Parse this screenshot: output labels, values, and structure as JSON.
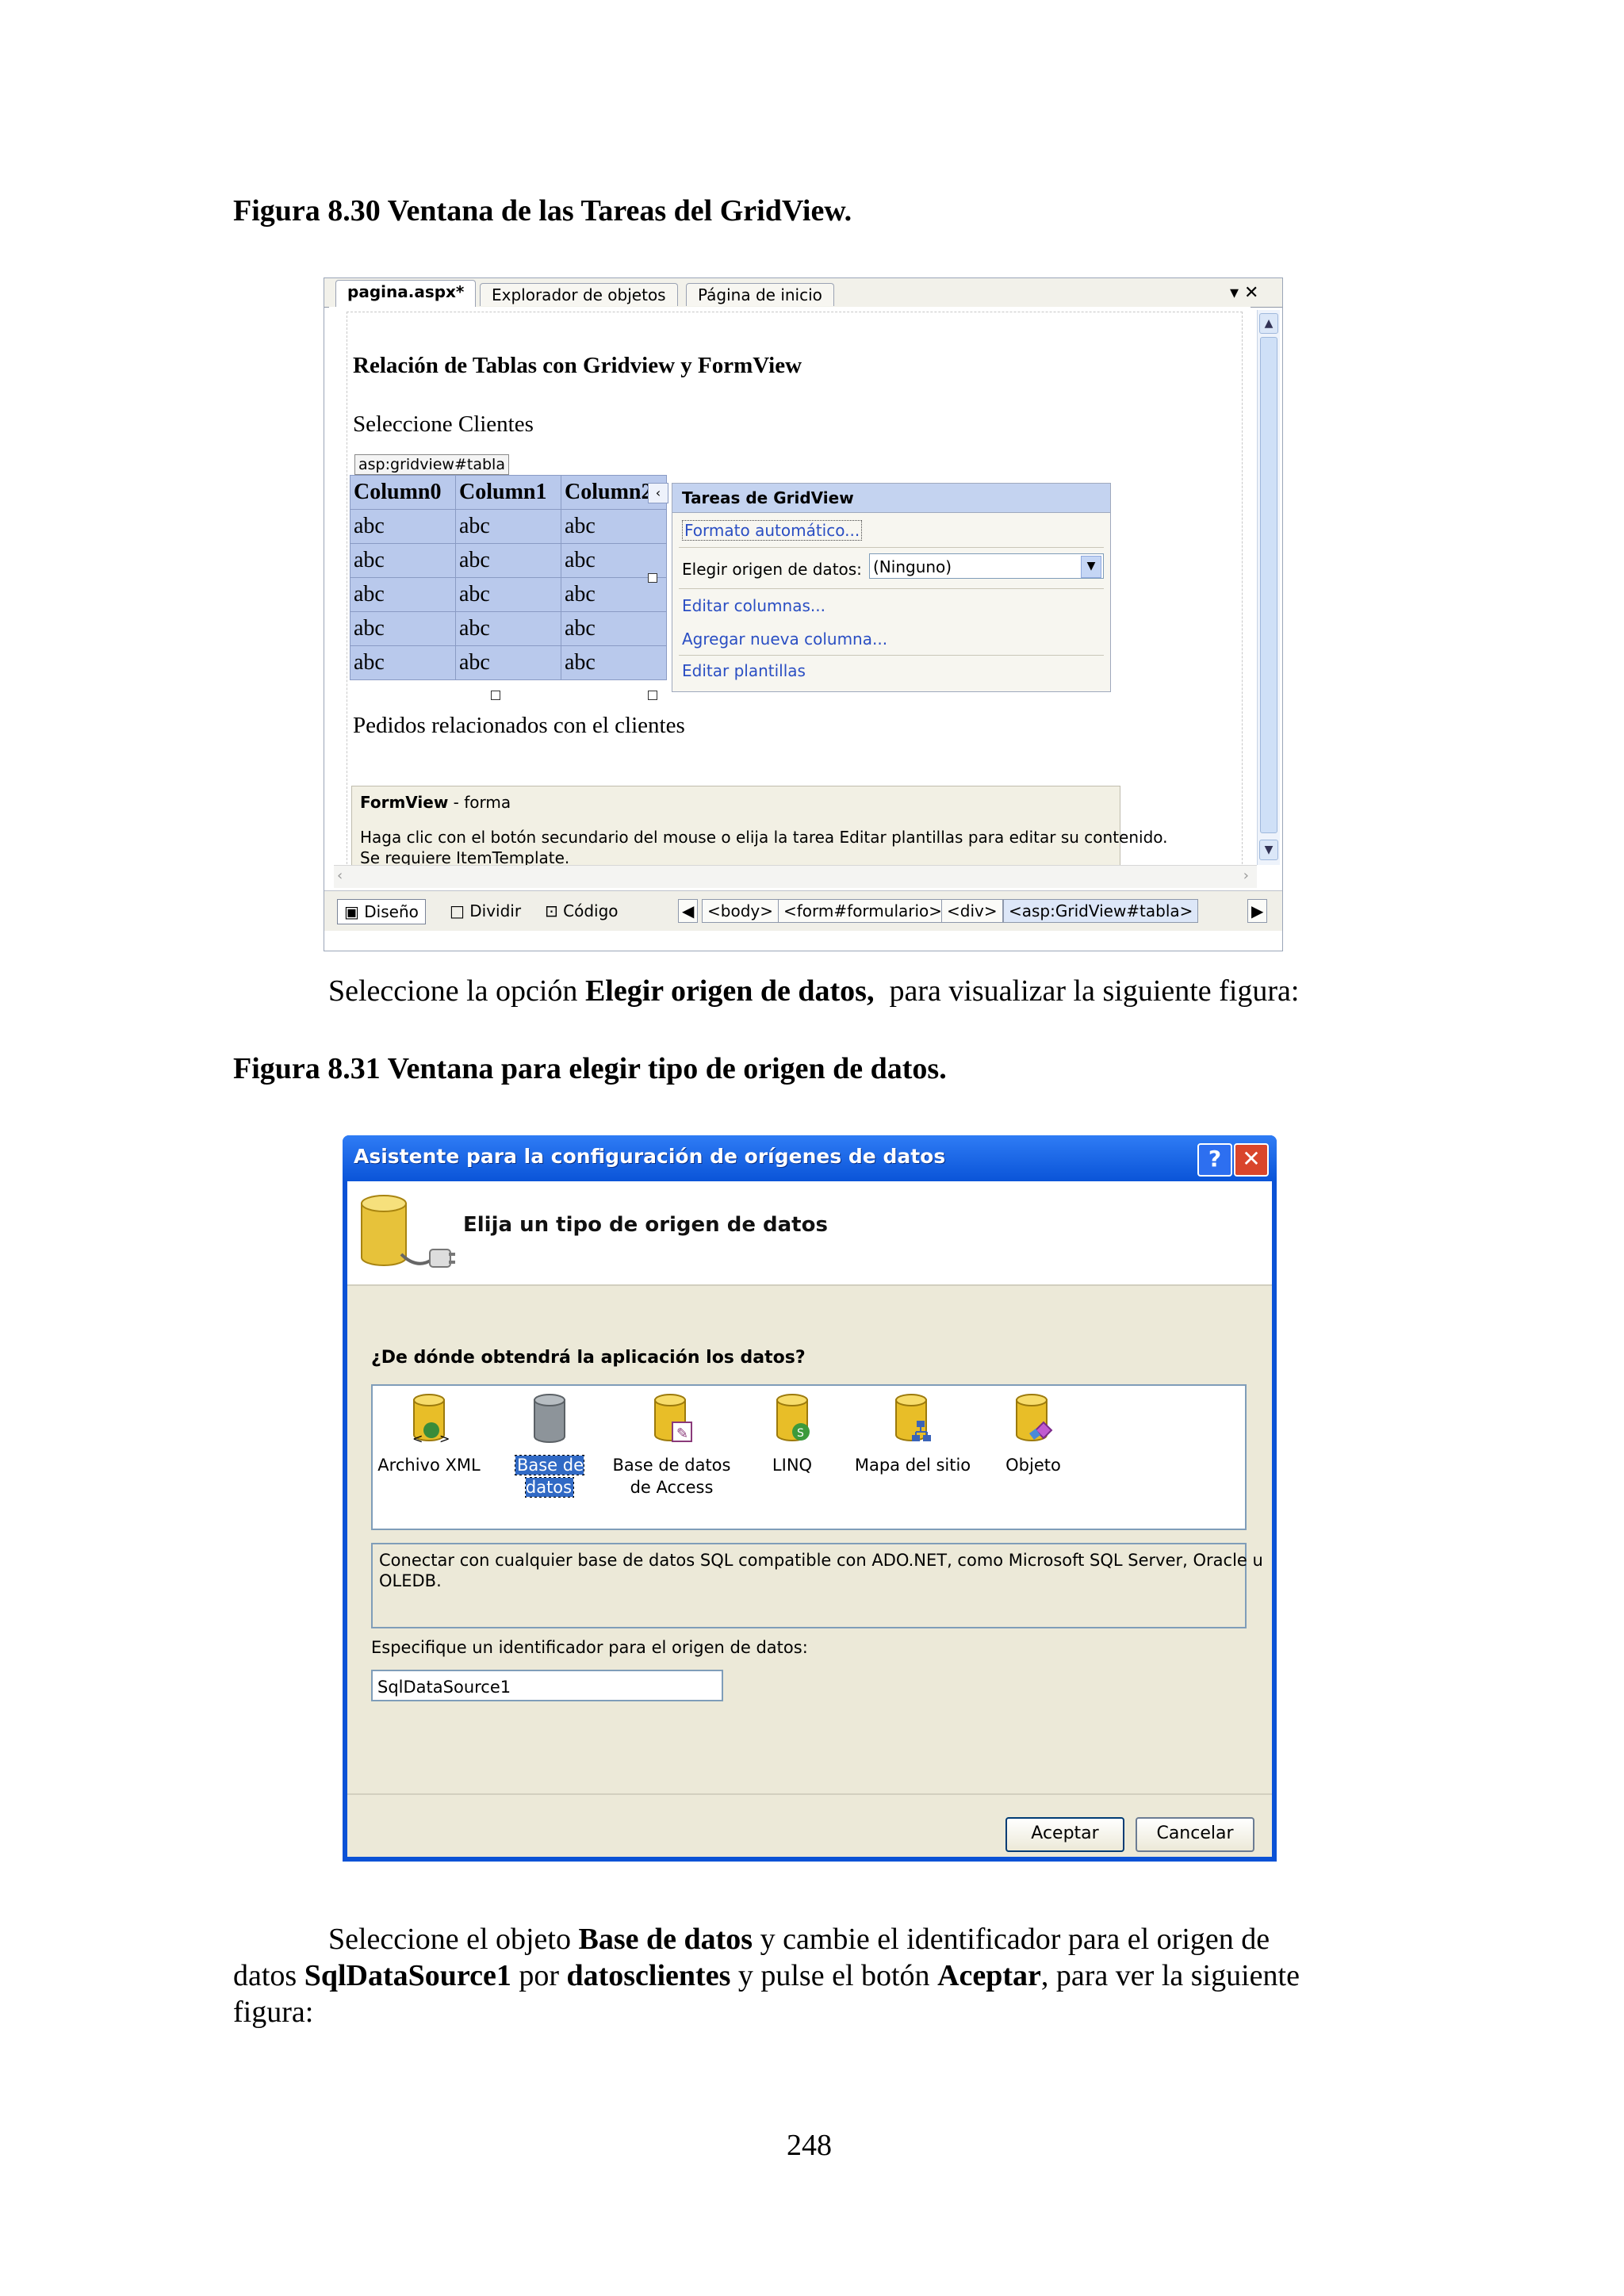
{
  "fig830": {
    "caption": "Figura 8.30 Ventana de las Tareas del GridView."
  },
  "vs": {
    "tabs": [
      "pagina.aspx*",
      "Explorador de objetos",
      "Página de inicio"
    ],
    "close_symbol": "▾ ✕",
    "heading": "Relación de Tablas con Gridview y FormView",
    "select_clients": "Seleccione Clientes",
    "gridview_tag": "asp:gridview#tabla",
    "grid": {
      "headers": [
        "Column0",
        "Column1",
        "Column2"
      ],
      "rows": [
        [
          "abc",
          "abc",
          "abc"
        ],
        [
          "abc",
          "abc",
          "abc"
        ],
        [
          "abc",
          "abc",
          "abc"
        ],
        [
          "abc",
          "abc",
          "abc"
        ],
        [
          "abc",
          "abc",
          "abc"
        ]
      ]
    },
    "tasks": {
      "title": "Tareas de GridView",
      "auto_format": "Formato automático...",
      "datasource_label": "Elegir origen de datos:",
      "datasource_value": "(Ninguno)",
      "edit_columns": "Editar columnas...",
      "add_column": "Agregar nueva columna...",
      "edit_templates": "Editar plantillas"
    },
    "related_orders": "Pedidos relacionados con el clientes",
    "formview": {
      "name_bold": "FormView",
      "name_rest": " - forma",
      "line1": "Haga clic con el botón secundario del mouse o elija la tarea Editar plantillas para editar su contenido.",
      "line2": "Se requiere ItemTemplate."
    },
    "bottom": {
      "design": "Diseño",
      "split": "Dividir",
      "code": "Código",
      "crumbs": [
        "<body>",
        "<form#formulario>",
        "<div>",
        "<asp:GridView#tabla>"
      ]
    }
  },
  "para1": {
    "pre": "Seleccione la opción ",
    "bold": "Elegir origen de datos,",
    "post": "  para visualizar la siguiente figura:"
  },
  "fig831": {
    "caption": "Figura 8.31 Ventana para elegir tipo de origen de datos."
  },
  "dialog": {
    "title": "Asistente para la configuración de orígenes de datos",
    "help_symbol": "?",
    "close_symbol": "✕",
    "header": "Elija un tipo de origen de datos",
    "question": "¿De dónde obtendrá la aplicación los datos?",
    "choices": [
      {
        "line1": "Archivo XML",
        "line2": ""
      },
      {
        "line1": "Base de datos",
        "line2": ""
      },
      {
        "line1": "Base de datos",
        "line2": "de Access"
      },
      {
        "line1": "LINQ",
        "line2": ""
      },
      {
        "line1": "Mapa del sitio",
        "line2": ""
      },
      {
        "line1": "Objeto",
        "line2": ""
      }
    ],
    "description_line1": "Conectar con cualquier base de datos SQL compatible con ADO.NET, como Microsoft SQL Server, Oracle u",
    "description_line2": "OLEDB.",
    "id_label": "Especifique un identificador para el origen de datos:",
    "id_value": "SqlDataSource1",
    "ok": "Aceptar",
    "cancel": "Cancelar",
    "colors": {
      "title_bar": "#0a54d8",
      "selection": "#316ac5",
      "close_button": "#d9452b"
    }
  },
  "para2": {
    "s1": "Seleccione el objeto ",
    "b1": "Base de datos",
    "s2": " y cambie el identificador para el origen de",
    "s3": "datos ",
    "b2": "SqlDataSource1",
    "s4": " por ",
    "b3": "datosclientes",
    "s5": " y pulse el botón ",
    "b4": "Aceptar",
    "s6": ", para ver la siguiente",
    "s7": "figura:"
  },
  "page_number": "248"
}
